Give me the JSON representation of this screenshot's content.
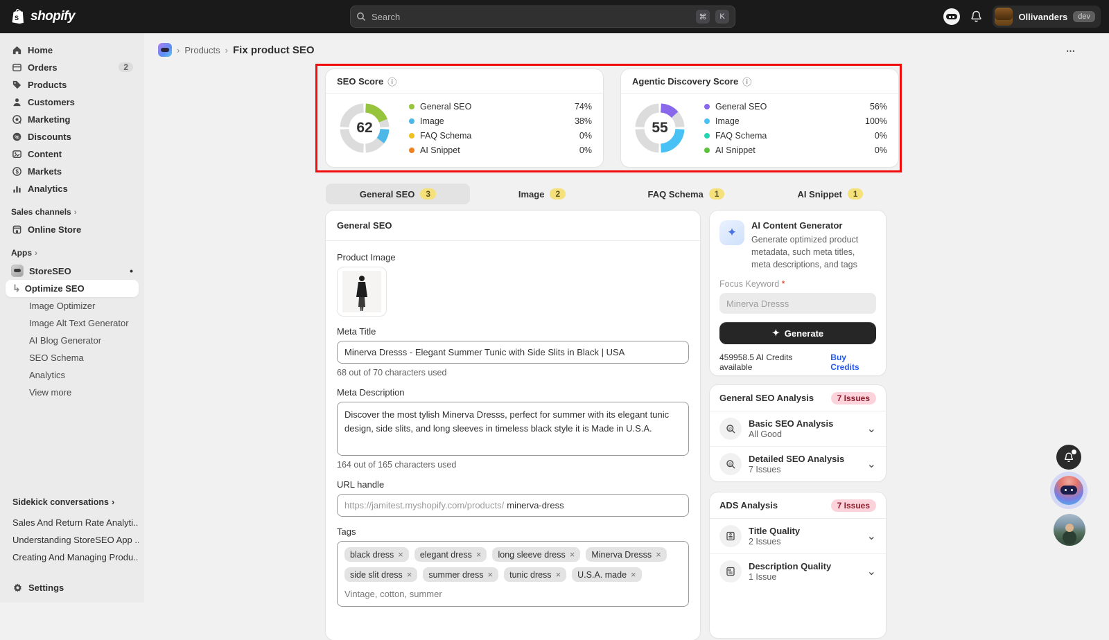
{
  "glyphs": {
    "chevron": "›",
    "info": "ⓘ",
    "more": "⋯",
    "caret": "⌄",
    "return": "↳",
    "dot": "•",
    "sparkle": "✦",
    "remove": "×"
  },
  "topbar": {
    "brand": "shopify",
    "search_placeholder": "Search",
    "shortcut_cmd": "⌘",
    "shortcut_k": "K",
    "store_name": "Ollivanders",
    "env_badge": "dev"
  },
  "sidebar": {
    "nav": [
      {
        "label": "Home",
        "badge": ""
      },
      {
        "label": "Orders",
        "badge": "2"
      },
      {
        "label": "Products",
        "badge": ""
      },
      {
        "label": "Customers",
        "badge": ""
      },
      {
        "label": "Marketing",
        "badge": ""
      },
      {
        "label": "Discounts",
        "badge": ""
      },
      {
        "label": "Content",
        "badge": ""
      },
      {
        "label": "Markets",
        "badge": ""
      },
      {
        "label": "Analytics",
        "badge": ""
      }
    ],
    "sales_channels_label": "Sales channels",
    "online_store_label": "Online Store",
    "apps_label": "Apps",
    "app_name": "StoreSEO",
    "app_items": [
      {
        "label": "Optimize SEO"
      },
      {
        "label": "Image Optimizer"
      },
      {
        "label": "Image Alt Text Generator"
      },
      {
        "label": "AI Blog Generator"
      },
      {
        "label": "SEO Schema"
      },
      {
        "label": "Analytics"
      },
      {
        "label": "View more"
      }
    ],
    "sidekick_label": "Sidekick conversations",
    "conversations": [
      "Sales And Return Rate Analyti...",
      "Understanding StoreSEO App ...",
      "Creating And Managing Produ..."
    ],
    "settings_label": "Settings"
  },
  "breadcrumb": {
    "parent": "Products",
    "current": "Fix product SEO"
  },
  "score_cards": [
    {
      "title": "SEO Score",
      "score": "62",
      "legend": [
        {
          "label": "General SEO",
          "value": "74%",
          "color": "#97c43d"
        },
        {
          "label": "Image",
          "value": "38%",
          "color": "#4bb8e8"
        },
        {
          "label": "FAQ Schema",
          "value": "0%",
          "color": "#f0c020"
        },
        {
          "label": "AI Snippet",
          "value": "0%",
          "color": "#ee8122"
        }
      ],
      "segments": [
        {
          "color": "#97c43d",
          "start": -87,
          "end": -22
        },
        {
          "color": "#4bb8e8",
          "start": 3,
          "end": 38
        }
      ]
    },
    {
      "title": "Agentic Discovery Score",
      "score": "55",
      "legend": [
        {
          "label": "General SEO",
          "value": "56%",
          "color": "#8a68ec"
        },
        {
          "label": "Image",
          "value": "100%",
          "color": "#48c2f5"
        },
        {
          "label": "FAQ Schema",
          "value": "0%",
          "color": "#25d4b0"
        },
        {
          "label": "AI Snippet",
          "value": "0%",
          "color": "#5bc23a"
        }
      ],
      "segments": [
        {
          "color": "#8a68ec",
          "start": -87,
          "end": -42
        },
        {
          "color": "#48c2f5",
          "start": 3,
          "end": 87
        }
      ]
    }
  ],
  "tabs": [
    {
      "label": "General SEO",
      "count": "3"
    },
    {
      "label": "Image",
      "count": "2"
    },
    {
      "label": "FAQ Schema",
      "count": "1"
    },
    {
      "label": "AI Snippet",
      "count": "1"
    }
  ],
  "form": {
    "title": "General SEO",
    "product_image_label": "Product Image",
    "meta_title_label": "Meta Title",
    "meta_title_value": "Minerva Dresss - Elegant Summer Tunic with Side Slits in Black | USA",
    "meta_title_helper": "68 out of 70 characters used",
    "meta_description_label": "Meta Description",
    "meta_description_value": "Discover the most tylish Minerva Dresss, perfect for summer with its elegant tunic design, side slits, and long sleeves in timeless black style it is Made in U.S.A.",
    "meta_description_helper": "164 out of 165 characters used",
    "url_label": "URL handle",
    "url_prefix": "https://jamitest.myshopify.com/products/",
    "url_value": "minerva-dress",
    "tags_label": "Tags",
    "tags": [
      "black dress",
      "elegant dress",
      "long sleeve dress",
      "Minerva Dresss",
      "side slit dress",
      "summer dress",
      "tunic dress",
      "U.S.A. made"
    ],
    "tags_placeholder": "Vintage, cotton, summer"
  },
  "ai_generator": {
    "title": "AI Content Generator",
    "description": "Generate optimized product metadata, such meta titles, meta descriptions, and tags",
    "focus_label": "Focus Keyword",
    "required_mark": "*",
    "focus_placeholder": "Minerva Dresss",
    "generate_label": "Generate",
    "credits_text": "459958.5 AI Credits available",
    "buy_link": "Buy Credits"
  },
  "seo_analysis": {
    "title": "General SEO Analysis",
    "badge": "7 Issues",
    "rows": [
      {
        "title": "Basic SEO Analysis",
        "sub": "All Good"
      },
      {
        "title": "Detailed SEO Analysis",
        "sub": "7 Issues"
      }
    ]
  },
  "ads_analysis": {
    "title": "ADS Analysis",
    "badge": "7 Issues",
    "rows": [
      {
        "title": "Title Quality",
        "sub": "2 Issues"
      },
      {
        "title": "Description Quality",
        "sub": "1 Issue"
      }
    ]
  }
}
